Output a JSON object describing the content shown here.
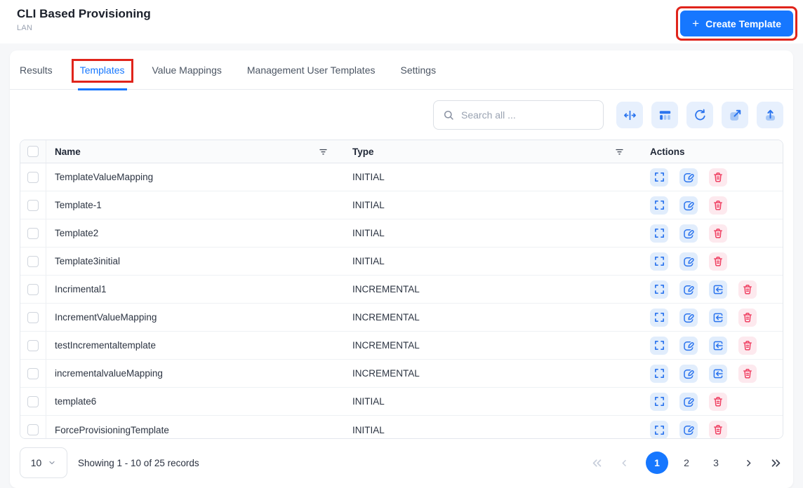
{
  "header": {
    "title": "CLI Based Provisioning",
    "subtitle": "LAN",
    "create_button": {
      "plus": "+",
      "label": "Create Template"
    }
  },
  "tabs": [
    {
      "label": "Results",
      "active": false
    },
    {
      "label": "Templates",
      "active": true,
      "annotated": true
    },
    {
      "label": "Value Mappings",
      "active": false
    },
    {
      "label": "Management User Templates",
      "active": false
    },
    {
      "label": "Settings",
      "active": false
    }
  ],
  "toolbar": {
    "search_placeholder": "Search all ...",
    "icons": [
      "autosize-columns-icon",
      "columns-icon",
      "refresh-icon",
      "open-external-icon",
      "upload-icon"
    ]
  },
  "table": {
    "headers": {
      "name": "Name",
      "type": "Type",
      "actions": "Actions"
    },
    "rows": [
      {
        "name": "TemplateValueMapping",
        "type": "INITIAL",
        "actions": [
          "expand",
          "edit",
          "delete"
        ]
      },
      {
        "name": "Template-1",
        "type": "INITIAL",
        "actions": [
          "expand",
          "edit",
          "delete"
        ]
      },
      {
        "name": "Template2",
        "type": "INITIAL",
        "actions": [
          "expand",
          "edit",
          "delete"
        ]
      },
      {
        "name": "Template3initial",
        "type": "INITIAL",
        "actions": [
          "expand",
          "edit",
          "delete"
        ]
      },
      {
        "name": "Incrimental1",
        "type": "INCREMENTAL",
        "actions": [
          "expand",
          "edit",
          "import",
          "delete"
        ]
      },
      {
        "name": "IncrementValueMapping",
        "type": "INCREMENTAL",
        "actions": [
          "expand",
          "edit",
          "import",
          "delete"
        ]
      },
      {
        "name": "testIncrementaltemplate",
        "type": "INCREMENTAL",
        "actions": [
          "expand",
          "edit",
          "import",
          "delete"
        ]
      },
      {
        "name": "incrementalvalueMapping",
        "type": "INCREMENTAL",
        "actions": [
          "expand",
          "edit",
          "import",
          "delete"
        ]
      },
      {
        "name": "template6",
        "type": "INITIAL",
        "actions": [
          "expand",
          "edit",
          "delete"
        ]
      },
      {
        "name": "ForceProvisioningTemplate",
        "type": "INITIAL",
        "actions": [
          "expand",
          "edit",
          "delete"
        ]
      }
    ]
  },
  "pagination": {
    "page_size": "10",
    "summary": "Showing 1 - 10 of 25 records",
    "pages": [
      "1",
      "2",
      "3"
    ],
    "active_page": "1"
  },
  "colors": {
    "primary": "#1677ff",
    "danger": "#ef3a5d",
    "annotation": "#e0241b",
    "chip_blue_bg": "#e1edfc",
    "chip_red_bg": "#fde9ee"
  }
}
